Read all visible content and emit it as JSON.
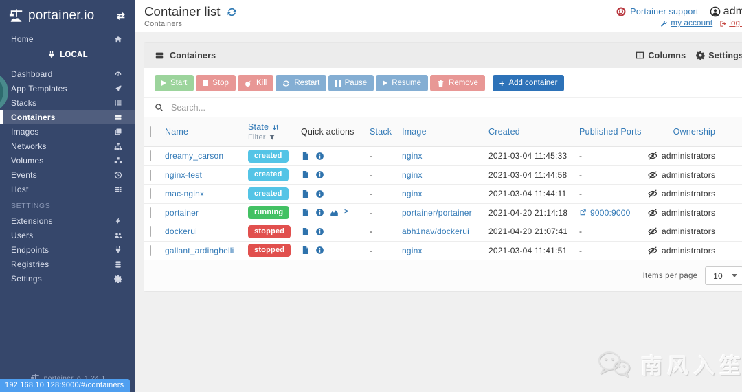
{
  "sidebar": {
    "logo": "portainer.io",
    "home": {
      "label": "Home"
    },
    "endpoint": {
      "label": "LOCAL"
    },
    "items": [
      {
        "label": "Dashboard"
      },
      {
        "label": "App Templates"
      },
      {
        "label": "Stacks"
      },
      {
        "label": "Containers"
      },
      {
        "label": "Images"
      },
      {
        "label": "Networks"
      },
      {
        "label": "Volumes"
      },
      {
        "label": "Events"
      },
      {
        "label": "Host"
      }
    ],
    "settings_header": "SETTINGS",
    "settings_items": [
      {
        "label": "Extensions"
      },
      {
        "label": "Users"
      },
      {
        "label": "Endpoints"
      },
      {
        "label": "Registries"
      },
      {
        "label": "Settings"
      }
    ],
    "footer_logo": "portainer.io",
    "footer_version": "1.24.1"
  },
  "status_bar": {
    "url": "192.168.10.128:9000/#/containers"
  },
  "header": {
    "title": "Container list",
    "breadcrumb": "Containers",
    "support_label": "Portainer support",
    "user_label": "admin",
    "my_account_label": "my account",
    "log_out_label": "log out"
  },
  "panel": {
    "title": "Containers",
    "columns_label": "Columns",
    "settings_label": "Settings"
  },
  "toolbar": {
    "start": "Start",
    "stop": "Stop",
    "kill": "Kill",
    "restart": "Restart",
    "pause": "Pause",
    "resume": "Resume",
    "remove": "Remove",
    "add_container": "Add container"
  },
  "search": {
    "placeholder": "Search..."
  },
  "table": {
    "headers": {
      "name": "Name",
      "state": "State",
      "filter": "Filter",
      "quick_actions": "Quick actions",
      "stack": "Stack",
      "image": "Image",
      "created": "Created",
      "ports": "Published Ports",
      "ownership": "Ownership"
    },
    "state_colors": {
      "created": "#54c4e6",
      "running": "#43c163",
      "stopped": "#e1504e"
    },
    "rows": [
      {
        "name": "dreamy_carson",
        "state": "created",
        "stack": "-",
        "image": "nginx",
        "created": "2021-03-04 11:45:33",
        "ports": "-",
        "ownership": "administrators"
      },
      {
        "name": "nginx-test",
        "state": "created",
        "stack": "-",
        "image": "nginx",
        "created": "2021-03-04 11:44:58",
        "ports": "-",
        "ownership": "administrators"
      },
      {
        "name": "mac-nginx",
        "state": "created",
        "stack": "-",
        "image": "nginx",
        "created": "2021-03-04 11:44:11",
        "ports": "-",
        "ownership": "administrators"
      },
      {
        "name": "portainer",
        "state": "running",
        "stack": "-",
        "image": "portainer/portainer",
        "created": "2021-04-20 21:14:18",
        "ports": "9000:9000",
        "ownership": "administrators"
      },
      {
        "name": "dockerui",
        "state": "stopped",
        "stack": "-",
        "image": "abh1nav/dockerui",
        "created": "2021-04-20 21:07:41",
        "ports": "-",
        "ownership": "administrators"
      },
      {
        "name": "gallant_ardinghelli",
        "state": "stopped",
        "stack": "-",
        "image": "nginx",
        "created": "2021-03-04 11:41:51",
        "ports": "-",
        "ownership": "administrators"
      }
    ]
  },
  "footer": {
    "items_per_page_label": "Items per page",
    "items_per_page_value": "10"
  },
  "watermark": {
    "text": "南风入笙"
  },
  "colors": {
    "accent": "#337ab7",
    "sidebar_bg": "#36476b",
    "add_button": "#2d72b8",
    "chip_bg": "#4f9ff0"
  }
}
